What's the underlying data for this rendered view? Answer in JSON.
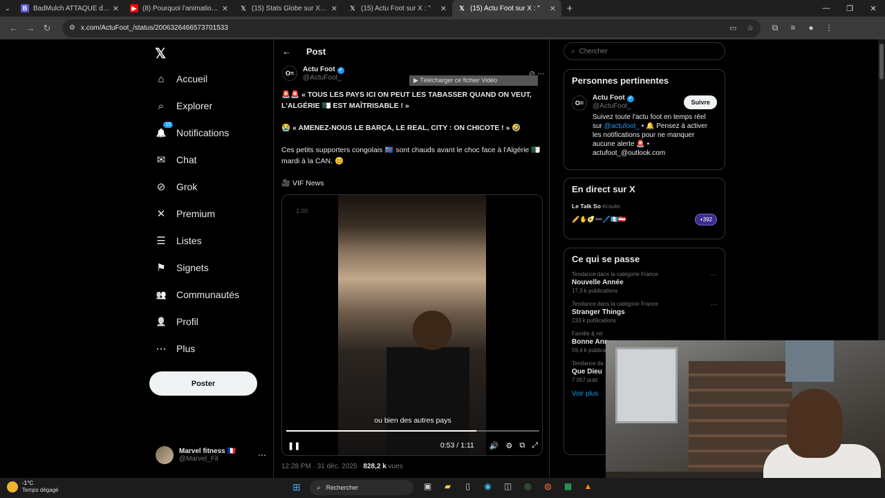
{
  "browser": {
    "tabs": [
      {
        "title": "BadMulch ATTAQUÉ dans LIBÉ",
        "icon": "bookmark-icon",
        "active": false
      },
      {
        "title": "(8) Pourquoi l'animation japonaise",
        "icon": "youtube-icon",
        "active": false
      },
      {
        "title": "(15) Stats Globe sur X : \"Year W",
        "icon": "x-icon",
        "active": false
      },
      {
        "title": "(15) Actu Foot sur X : \"",
        "icon": "x-icon",
        "active": false
      },
      {
        "title": "(15) Actu Foot sur X : \"",
        "icon": "x-icon",
        "active": true
      }
    ],
    "url": "x.com/ActuFoot_/status/2006326466573701533",
    "new_tab_label": "+",
    "window_controls": [
      "—",
      "❐",
      "✕"
    ]
  },
  "nav": {
    "logo": "𝕏",
    "items": [
      {
        "label": "Accueil",
        "icon": "home-icon",
        "glyph": "⌂"
      },
      {
        "label": "Explorer",
        "icon": "search-icon",
        "glyph": "⌕"
      },
      {
        "label": "Notifications",
        "icon": "bell-icon",
        "glyph": "🔔",
        "badge": "15"
      },
      {
        "label": "Chat",
        "icon": "mail-icon",
        "glyph": "✉"
      },
      {
        "label": "Grok",
        "icon": "grok-icon",
        "glyph": "⊘"
      },
      {
        "label": "Premium",
        "icon": "x-icon",
        "glyph": "✕"
      },
      {
        "label": "Listes",
        "icon": "list-icon",
        "glyph": "☰"
      },
      {
        "label": "Signets",
        "icon": "bookmark-icon",
        "glyph": "⚑"
      },
      {
        "label": "Communautés",
        "icon": "communities-icon",
        "glyph": "👥"
      },
      {
        "label": "Profil",
        "icon": "profile-icon",
        "glyph": "👤"
      },
      {
        "label": "Plus",
        "icon": "more-icon",
        "glyph": "⋯"
      }
    ],
    "post_button": "Poster",
    "account": {
      "name": "Marvel fitness 🇫🇷",
      "handle": "@Marvel_Fit"
    }
  },
  "post": {
    "header": "Post",
    "author_name": "Actu Foot",
    "author_handle": "@ActuFoot_",
    "download_overlay": "▶ Télécharger ce fichier Vidéo",
    "paragraph1": "🚨🚨 « TOUS LES PAYS ICI ON PEUT LES TABASSER QUAND ON VEUT, L'ALGÉRIE 🇩🇿 EST MAÎTRISABLE ! »",
    "paragraph2": "😭 « AMENEZ-NOUS LE BARÇA, LE REAL, CITY : ON CHICOTE ! » 🤣",
    "paragraph3": "Ces petits supporters congolais 🇨🇩 sont chauds avant le choc face à l'Algérie 🇩🇿 mardi à la CAN. 😊",
    "source": "🎥 VIF News",
    "video": {
      "watermark": "1.00",
      "subtitle": "ou bien des autres pays",
      "time": "0:53 / 1:11",
      "progress": 0.75
    },
    "timestamp": "12:28 PM · 31 déc. 2025 · ",
    "views_count": "828,2 k",
    "views_label": " vues"
  },
  "sidebar": {
    "search_placeholder": "Chercher",
    "relevant": {
      "title": "Personnes pertinentes",
      "name": "Actu Foot",
      "handle": "@ActuFoot_",
      "follow": "Suivre",
      "bio_before": "Suivez toute l'actu foot en temps réel sur ",
      "bio_link": "@actufoot_",
      "bio_after": " • 🔔 Pensez à activer les notifications pour ne manquer aucune alerte 🚨 • actufoot_@outlook.com"
    },
    "live": {
      "title": "En direct sur X",
      "host": "Le Talk So",
      "host_suffix": " écoute.",
      "emojis": "🥖✋🥑➖🖊️🇬🇹🇦🇹",
      "listeners": "+392"
    },
    "trends": {
      "title": "Ce qui se passe",
      "items": [
        {
          "category": "Tendance dans la catégorie France",
          "name": "Nouvelle Année",
          "count": "17,3 k publications"
        },
        {
          "category": "Tendance dans la catégorie France",
          "name": "Stranger Things",
          "count": "233 k publications"
        },
        {
          "category": "Famille & rel",
          "name": "Bonne Ann",
          "count": "59,4 k publications"
        },
        {
          "category": "Tendance da",
          "name": "Que Dieu",
          "count": "7 057 publ"
        }
      ],
      "see_more": "Voir plus"
    }
  },
  "taskbar": {
    "temp": "-1°C",
    "condition": "Temps dégagé",
    "search": "Rechercher"
  }
}
